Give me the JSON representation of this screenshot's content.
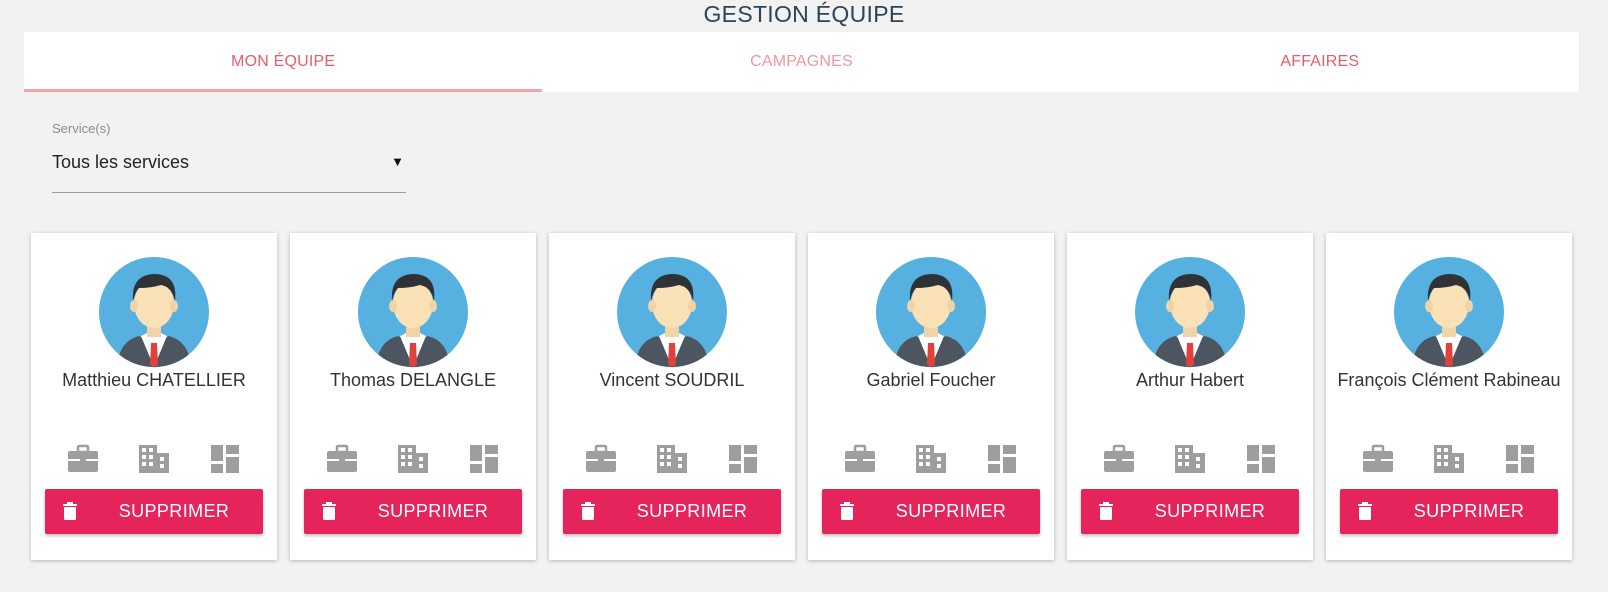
{
  "page": {
    "title": "GESTION ÉQUIPE"
  },
  "tabs": [
    {
      "label": "MON ÉQUIPE",
      "active": true
    },
    {
      "label": "CAMPAGNES",
      "active": false
    },
    {
      "label": "AFFAIRES",
      "active": false
    }
  ],
  "service_filter": {
    "label": "Service(s)",
    "value": "Tous les services",
    "caret": "▼"
  },
  "members": [
    {
      "name": "Matthieu CHATELLIER",
      "delete_label": "SUPPRIMER"
    },
    {
      "name": "Thomas DELANGLE",
      "delete_label": "SUPPRIMER"
    },
    {
      "name": "Vincent SOUDRIL",
      "delete_label": "SUPPRIMER"
    },
    {
      "name": "Gabriel Foucher",
      "delete_label": "SUPPRIMER"
    },
    {
      "name": "Arthur Habert",
      "delete_label": "SUPPRIMER"
    },
    {
      "name": "François Clément Rabineau",
      "delete_label": "SUPPRIMER"
    }
  ],
  "icons": {
    "actions": [
      "briefcase-icon",
      "building-icon",
      "dashboard-icon"
    ],
    "delete": "trash-icon",
    "avatar": "businessman-avatar-icon"
  },
  "colors": {
    "accent": "#e5245c",
    "tab_text": "#e35d6a",
    "tab_indicator": "#f4a3a8",
    "avatar_bg": "#56b1e1",
    "icon_gray": "#9e9e9e",
    "title": "#2c4457"
  }
}
